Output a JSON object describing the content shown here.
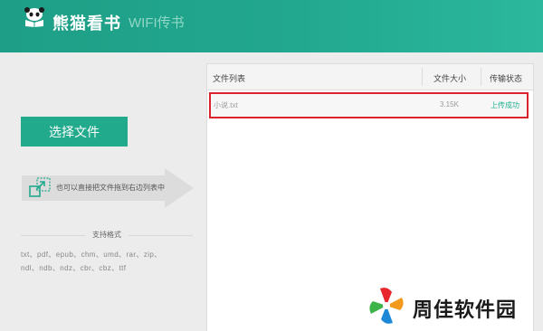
{
  "header": {
    "app_name": "熊猫看书",
    "app_subtitle": "WIFI传书",
    "logo_icon": "panda-book-icon"
  },
  "left_panel": {
    "select_button_label": "选择文件",
    "drag_hint": "也可以直接把文件拖到右边列表中",
    "drag_icon": "drag-expand-icon",
    "formats_title": "支持格式",
    "formats_lines": [
      "txt、pdf、epub、chm、umd、rar、zip、",
      "ndl、ndb、ndz、cbr、cbz、ttf"
    ]
  },
  "file_list": {
    "columns": [
      "文件列表",
      "文件大小",
      "传输状态"
    ],
    "rows": [
      {
        "name": "小说.txt",
        "size": "3.15K",
        "status": "上传成功"
      }
    ]
  },
  "watermark": {
    "text": "周佳软件园",
    "logo_icon": "pinwheel-logo-icon"
  },
  "colors": {
    "header_bg": "#22a88f",
    "accent": "#21aa8c",
    "highlight_border": "#d9232d",
    "status_success": "#1fb092"
  }
}
